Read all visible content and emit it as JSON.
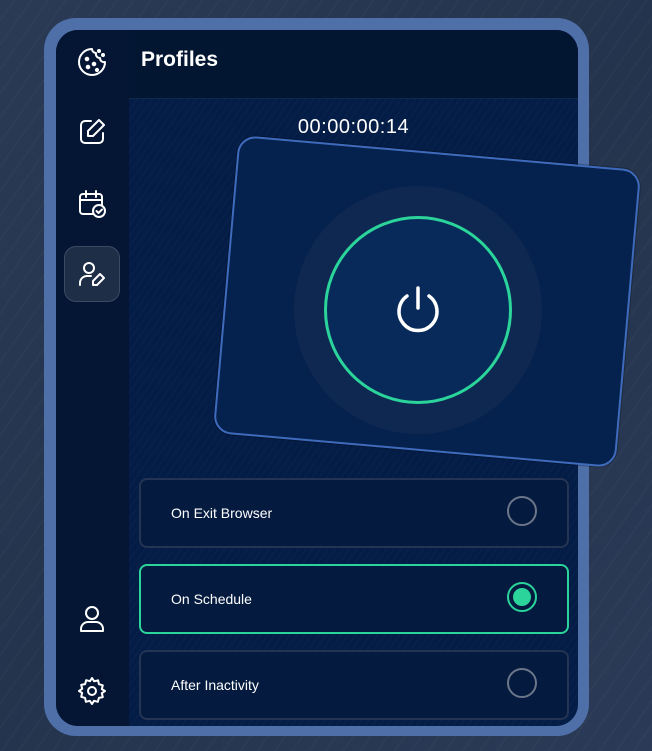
{
  "header": {
    "title": "Profiles"
  },
  "timer": {
    "value": "00:00:00:14"
  },
  "sidebar": {
    "items": [
      {
        "name": "cookie-icon",
        "active": false
      },
      {
        "name": "edit-icon",
        "active": false
      },
      {
        "name": "calendar-check-icon",
        "active": false
      },
      {
        "name": "user-edit-icon",
        "active": true
      },
      {
        "name": "user-icon",
        "active": false
      },
      {
        "name": "gear-icon",
        "active": false
      }
    ]
  },
  "power": {
    "icon": "power-icon",
    "state": "on"
  },
  "options": [
    {
      "label": "On Exit Browser",
      "selected": false
    },
    {
      "label": "On Schedule",
      "selected": true
    },
    {
      "label": "After Inactivity",
      "selected": false
    }
  ],
  "colors": {
    "accent": "#2bd49a",
    "background": "#041d47",
    "frame": "#4f6fa8"
  }
}
